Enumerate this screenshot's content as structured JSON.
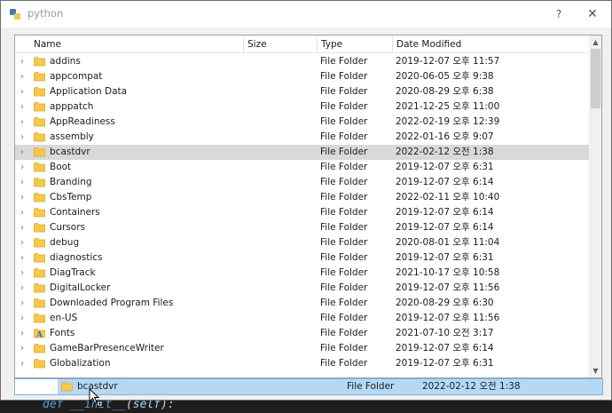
{
  "window": {
    "title": "python",
    "help_label": "?",
    "close_label": "✕"
  },
  "columns": {
    "name": "Name",
    "size": "Size",
    "type": "Type",
    "date": "Date Modified"
  },
  "rows": [
    {
      "name": "addins",
      "type": "File Folder",
      "date": "2019-12-07 오후 11:57",
      "icon": "folder-icon"
    },
    {
      "name": "appcompat",
      "type": "File Folder",
      "date": "2020-06-05 오후 9:38",
      "icon": "folder-icon"
    },
    {
      "name": "Application Data",
      "type": "File Folder",
      "date": "2020-08-29 오후 6:38",
      "icon": "folder-icon"
    },
    {
      "name": "apppatch",
      "type": "File Folder",
      "date": "2021-12-25 오후 11:00",
      "icon": "folder-icon"
    },
    {
      "name": "AppReadiness",
      "type": "File Folder",
      "date": "2022-02-19 오후 12:39",
      "icon": "folder-icon"
    },
    {
      "name": "assembly",
      "type": "File Folder",
      "date": "2022-01-16 오후 9:07",
      "icon": "folder-icon"
    },
    {
      "name": "bcastdvr",
      "type": "File Folder",
      "date": "2022-02-12 오전 1:38",
      "icon": "folder-icon",
      "selected": true
    },
    {
      "name": "Boot",
      "type": "File Folder",
      "date": "2019-12-07 오후 6:31",
      "icon": "folder-icon"
    },
    {
      "name": "Branding",
      "type": "File Folder",
      "date": "2019-12-07 오후 6:14",
      "icon": "folder-icon"
    },
    {
      "name": "CbsTemp",
      "type": "File Folder",
      "date": "2022-02-11 오후 10:40",
      "icon": "folder-icon"
    },
    {
      "name": "Containers",
      "type": "File Folder",
      "date": "2019-12-07 오후 6:14",
      "icon": "folder-icon"
    },
    {
      "name": "Cursors",
      "type": "File Folder",
      "date": "2019-12-07 오후 6:14",
      "icon": "folder-icon"
    },
    {
      "name": "debug",
      "type": "File Folder",
      "date": "2020-08-01 오후 11:04",
      "icon": "folder-icon"
    },
    {
      "name": "diagnostics",
      "type": "File Folder",
      "date": "2019-12-07 오후 6:31",
      "icon": "folder-icon"
    },
    {
      "name": "DiagTrack",
      "type": "File Folder",
      "date": "2021-10-17 오후 10:58",
      "icon": "folder-icon"
    },
    {
      "name": "DigitalLocker",
      "type": "File Folder",
      "date": "2019-12-07 오후 11:56",
      "icon": "folder-icon"
    },
    {
      "name": "Downloaded Program Files",
      "type": "File Folder",
      "date": "2020-08-29 오후 6:30",
      "icon": "folder-icon"
    },
    {
      "name": "en-US",
      "type": "File Folder",
      "date": "2019-12-07 오후 11:56",
      "icon": "folder-icon"
    },
    {
      "name": "Fonts",
      "type": "File Folder",
      "date": "2021-07-10 오전 3:17",
      "icon": "fonts-folder-icon"
    },
    {
      "name": "GameBarPresenceWriter",
      "type": "File Folder",
      "date": "2019-12-07 오후 6:14",
      "icon": "folder-icon"
    },
    {
      "name": "Globalization",
      "type": "File Folder",
      "date": "2019-12-07 오후 6:31",
      "icon": "folder-icon"
    }
  ],
  "drag_item": {
    "name": "bcastdvr",
    "type": "File Folder",
    "date": "2022-02-12 오전 1:38"
  },
  "background_code": {
    "keyword": "def",
    "name": "__init__",
    "open": "(",
    "param": "self",
    "close": "):"
  },
  "colors": {
    "selection": "#d9d9d9",
    "drag_highlight": "#b6d8f2",
    "folder": "#f5c94a"
  }
}
